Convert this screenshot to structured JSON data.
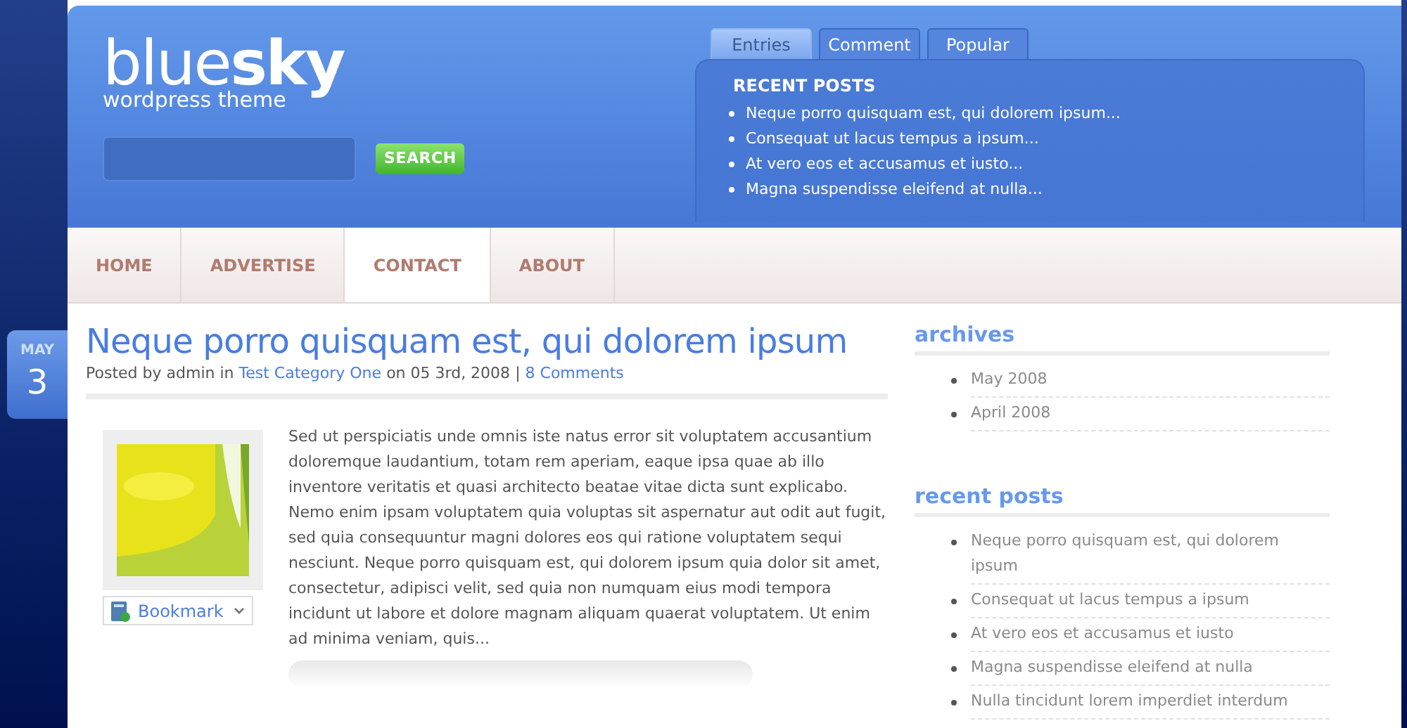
{
  "logo": {
    "light": "blue",
    "bold": "sky",
    "tagline": "wordpress theme"
  },
  "search": {
    "button": "SEARCH"
  },
  "widget_tabs": [
    {
      "label": "Entries",
      "selected": true
    },
    {
      "label": "Comment",
      "selected": false
    },
    {
      "label": "Popular",
      "selected": false
    }
  ],
  "widget": {
    "title": "RECENT POSTS",
    "items": [
      "Neque porro quisquam est, qui dolorem ipsum...",
      "Consequat ut lacus tempus a ipsum...",
      "At vero eos et accusamus et iusto...",
      "Magna suspendisse eleifend at nulla..."
    ]
  },
  "nav": [
    {
      "label": "HOME",
      "selected": false
    },
    {
      "label": "ADVERTISE",
      "selected": false
    },
    {
      "label": "CONTACT",
      "selected": true
    },
    {
      "label": "ABOUT",
      "selected": false
    }
  ],
  "post": {
    "date": {
      "month": "MAY",
      "day": "3"
    },
    "title": "Neque porro quisquam est, qui dolorem ipsum",
    "meta": {
      "prefix": "Posted by admin in",
      "category": "Test Category One",
      "date": "on 05 3rd, 2008",
      "separator": "|",
      "comments": "8 Comments"
    },
    "body": "Sed ut perspiciatis unde omnis iste natus error sit voluptatem accusantium doloremque laudantium, totam rem aperiam, eaque ipsa quae ab illo inventore veritatis et quasi architecto beatae vitae dicta sunt explicabo. Nemo enim ipsam voluptatem quia voluptas sit aspernatur aut odit aut fugit, sed quia consequuntur magni dolores eos qui ratione voluptatem sequi nesciunt. Neque porro quisquam est, qui dolorem ipsum quia dolor sit amet, consectetur, adipisci velit, sed quia non numquam eius modi tempora incidunt ut labore et dolore magnam aliquam quaerat voluptatem. Ut enim ad minima veniam, quis...",
    "bookmark": "Bookmark"
  },
  "sidebar": [
    {
      "title": "archives",
      "items": [
        "May 2008",
        "April 2008"
      ]
    },
    {
      "title": "recent posts",
      "items": [
        "Neque porro quisquam est, qui dolorem ipsum",
        "Consequat ut lacus tempus a ipsum",
        "At vero eos et accusamus et iusto",
        "Magna suspendisse eleifend at nulla",
        "Nulla tincidunt lorem imperdiet interdum"
      ]
    }
  ]
}
